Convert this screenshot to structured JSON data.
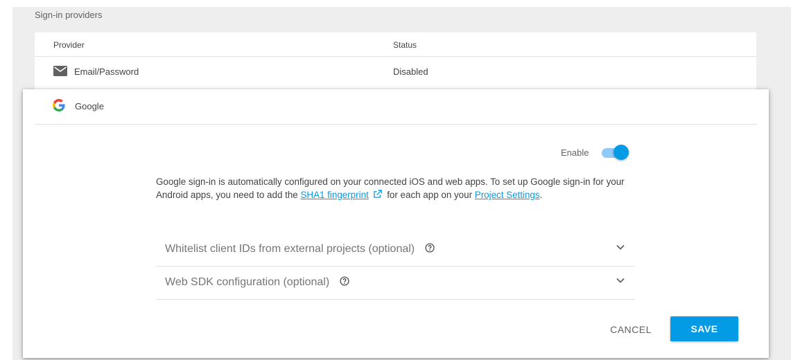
{
  "section_title": "Sign-in providers",
  "table": {
    "col_provider": "Provider",
    "col_status": "Status",
    "rows": [
      {
        "name": "Email/Password",
        "status": "Disabled",
        "icon": "mail-icon"
      }
    ]
  },
  "dialog": {
    "provider_name": "Google",
    "provider_icon": "google-logo-icon",
    "enable_label": "Enable",
    "enabled": true,
    "description_part1": "Google sign-in is automatically configured on your connected iOS and web apps. To set up Google sign-in for your Android apps, you need to add the",
    "sha1_link": "SHA1 fingerprint",
    "description_part2": "for each app on your",
    "project_settings_link": "Project Settings",
    "description_end": ".",
    "expanders": [
      {
        "label": "Whitelist client IDs from external projects (optional)"
      },
      {
        "label": "Web SDK configuration (optional)"
      }
    ],
    "cancel_label": "CANCEL",
    "save_label": "SAVE"
  },
  "colors": {
    "accent": "#039be5",
    "toggle_track": "#90caf9"
  }
}
